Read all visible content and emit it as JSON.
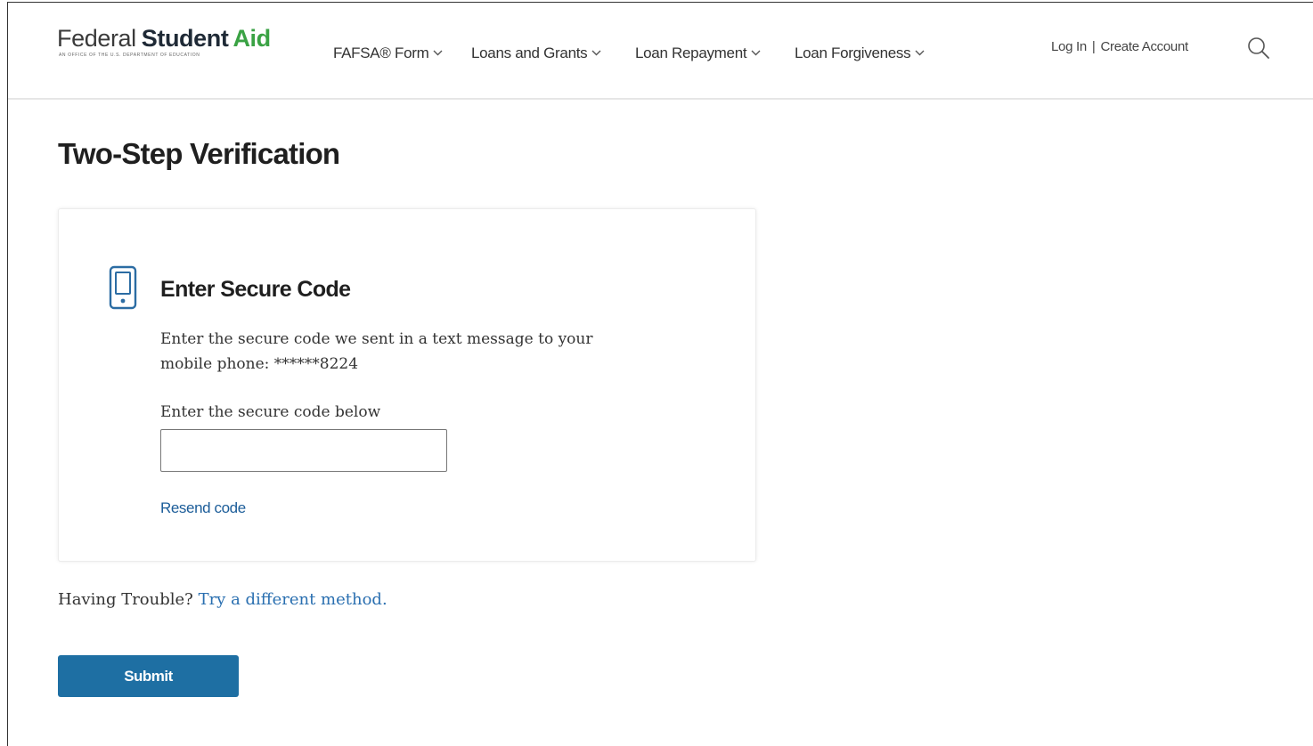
{
  "header": {
    "logo": {
      "federal": "Federal",
      "student": "Student",
      "aid": "Aid",
      "tagline": "An office of the U.S. Department of Education"
    },
    "nav": [
      {
        "label": "FAFSA® Form",
        "icon": "chevron-down-icon"
      },
      {
        "label": "Loans and Grants",
        "icon": "chevron-down-icon"
      },
      {
        "label": "Loan Repayment",
        "icon": "chevron-down-icon"
      },
      {
        "label": "Loan Forgiveness",
        "icon": "chevron-down-icon"
      }
    ],
    "login_label": "Log In",
    "separator": "|",
    "create_account_label": "Create Account",
    "search_icon": "search-icon"
  },
  "page": {
    "title": "Two-Step Verification"
  },
  "card": {
    "icon": "mobile-phone-icon",
    "title": "Enter Secure Code",
    "description": "Enter the secure code we sent in a text message to your mobile phone: ******8224",
    "input_label": "Enter the secure code below",
    "input_value": "",
    "resend_label": "Resend code"
  },
  "footer": {
    "trouble_text": "Having Trouble?",
    "alt_method_label": "Try a different method.",
    "submit_label": "Submit"
  },
  "colors": {
    "brand_green": "#3aa244",
    "primary_button": "#1e6fa3",
    "link": "#1c5d99",
    "icon_blue": "#2b6ca3"
  }
}
